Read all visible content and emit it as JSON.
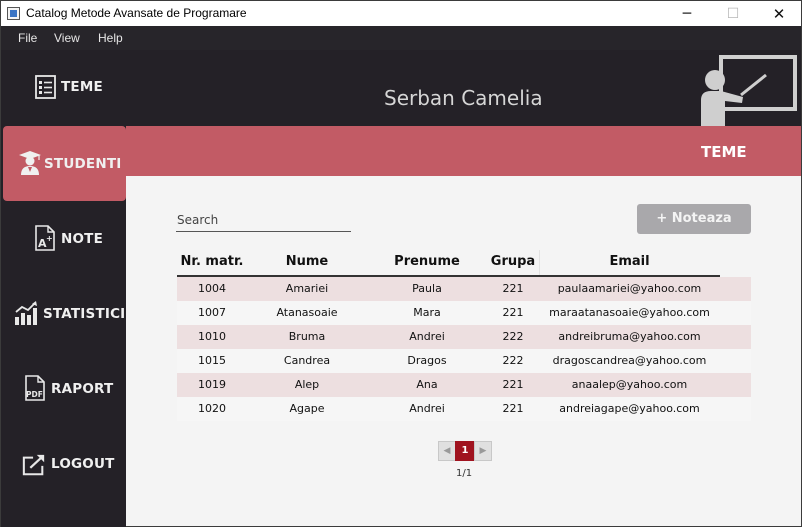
{
  "window": {
    "title": "Catalog Metode Avansate de Programare",
    "minimize": "─",
    "maximize": "☐",
    "close": "✕"
  },
  "menu": [
    "File",
    "View",
    "Help"
  ],
  "sidebar": {
    "items": [
      {
        "label": "TEME",
        "icon": "list-icon"
      },
      {
        "label": "STUDENTI",
        "icon": "student-icon",
        "active": true
      },
      {
        "label": "NOTE",
        "icon": "grade-document-icon"
      },
      {
        "label": "STATISTICI",
        "icon": "bar-chart-icon"
      },
      {
        "label": "RAPORT",
        "icon": "pdf-icon"
      },
      {
        "label": "LOGOUT",
        "icon": "logout-icon"
      }
    ],
    "active_color": "#c25b65"
  },
  "header": {
    "user_name": "Serban Camelia",
    "icon": "teacher-icon"
  },
  "banner": {
    "title": "TEME"
  },
  "search": {
    "placeholder": "Search",
    "value": ""
  },
  "actions": {
    "note_button": "+ Noteaza"
  },
  "table": {
    "columns": [
      "Nr. matr.",
      "Nume",
      "Prenume",
      "Grupa",
      "Email"
    ],
    "rows": [
      [
        "1004",
        "Amariei",
        "Paula",
        "221",
        "paulaamariei@yahoo.com"
      ],
      [
        "1007",
        "Atanasoaie",
        "Mara",
        "221",
        "maraatanasoaie@yahoo.com"
      ],
      [
        "1010",
        "Bruma",
        "Andrei",
        "222",
        "andreibruma@yahoo.com"
      ],
      [
        "1015",
        "Candrea",
        "Dragos",
        "222",
        "dragoscandrea@yahoo.com"
      ],
      [
        "1019",
        "Alep",
        "Ana",
        "221",
        "anaalep@yahoo.com"
      ],
      [
        "1020",
        "Agape",
        "Andrei",
        "221",
        "andreiagape@yahoo.com"
      ]
    ]
  },
  "pagination": {
    "prev": "◀",
    "current": "1",
    "next": "▶",
    "page_info": "1/1"
  },
  "colors": {
    "accent": "#c25b65",
    "dark": "#242127",
    "page_active": "#a0131f"
  }
}
